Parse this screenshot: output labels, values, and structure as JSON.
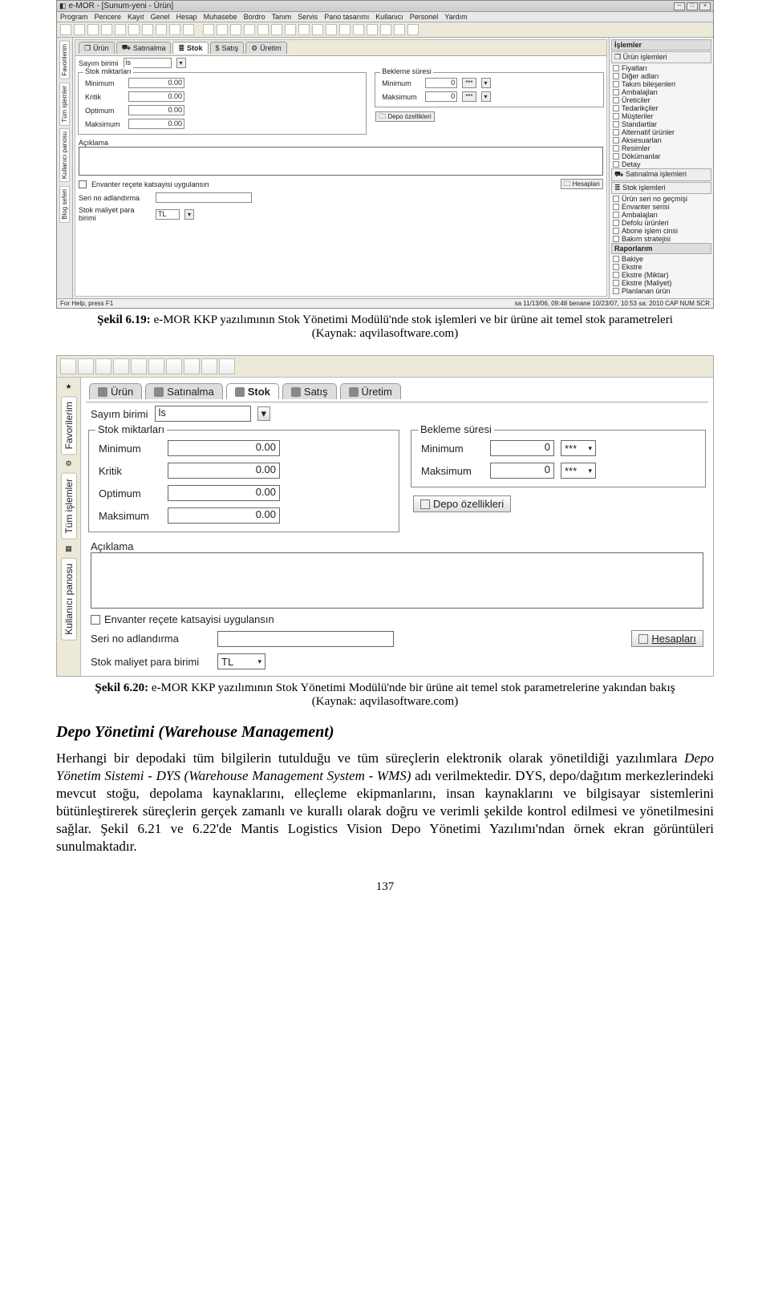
{
  "shot1": {
    "window_title": "e-MOR - [Sunum-yeni - Ürün]",
    "menus": [
      "Program",
      "Pencere",
      "Kayıt",
      "Genel",
      "Hesap",
      "Muhasebe",
      "Bordro",
      "Tanım",
      "Servis",
      "Pano tasarımı",
      "Kullanıcı",
      "Personel",
      "Yardım"
    ],
    "left_tabs": [
      "Favorilerim",
      "Tüm işlemler",
      "Kullanıcı panosu",
      "Blog seferi"
    ],
    "tabs": [
      "Ürün",
      "Satınalma",
      "Stok",
      "Satış",
      "Üretim"
    ],
    "sayim_label": "Sayım birimi",
    "sayim_value": "ls",
    "stok_group": {
      "title": "Stok miktarları",
      "rows": [
        {
          "label": "Minimum",
          "value": "0.00"
        },
        {
          "label": "Kritik",
          "value": "0.00"
        },
        {
          "label": "Optimum",
          "value": "0.00"
        },
        {
          "label": "Maksimum",
          "value": "0.00"
        }
      ]
    },
    "bekleme_group": {
      "title": "Bekleme süresi",
      "rows": [
        {
          "label": "Minimum",
          "value": "0",
          "unit": "***"
        },
        {
          "label": "Maksimum",
          "value": "0",
          "unit": "***"
        }
      ]
    },
    "depo_btn": "Depo özellikleri",
    "aciklama_label": "Açıklama",
    "envanter_label": "Envanter reçete katsayisi uygulansın",
    "hesap_btn": "Hesapları",
    "seri_label": "Seri no adlandırma",
    "maliyet_label": "Stok maliyet para birimi",
    "maliyet_value": "TL",
    "right": {
      "head1": "İşlemler",
      "grp1": "Ürün işlemleri",
      "items1": [
        "Fiyatları",
        "Diğer adları",
        "Takım bileşenleri",
        "Ambalajları",
        "Üreticiler",
        "Tedarikçiler",
        "Müşteriler",
        "Standartlar",
        "Alternatif ürünler",
        "Aksesuarları",
        "Resimler",
        "Dökümanlar",
        "Detay"
      ],
      "grp2": "Satınalma işlemleri",
      "grp3": "Stok işlemleri",
      "items3": [
        "Ürün seri no geçmişi",
        "Envanter serisi",
        "Ambalajları",
        "Defolu ürünleri",
        "Abone işlem cinsi",
        "Bakım stratejisi"
      ],
      "head2": "Raporlarım",
      "items4": [
        "Bakiye",
        "Ekstre",
        "Ekstre (Miktar)",
        "Ekstre (Maliyet)",
        "Planlanan ürün"
      ]
    },
    "status_left": "For Help, press F1",
    "status_right": "sa 11/13/06, 09:48    benane 10/23/07, 10:53    sa: 2010    CAP  NUM  SCR"
  },
  "caption1": {
    "bold": "Şekil 6.19: ",
    "text": "e-MOR KKP yazılımının Stok Yönetimi Modülü'nde stok işlemleri ve bir ürüne ait temel stok parametreleri",
    "source": "(Kaynak: aqvilasoftware.com)"
  },
  "shot2": {
    "left_tabs": [
      "Favorilerim",
      "Tüm işlemler",
      "Kullanıcı panosu"
    ],
    "tabs": [
      "Ürün",
      "Satınalma",
      "Stok",
      "Satış",
      "Üretim"
    ],
    "sayim_label": "Sayım birimi",
    "sayim_value": "ls",
    "stok_group": {
      "title": "Stok miktarları",
      "rows": [
        {
          "label": "Minimum",
          "value": "0.00"
        },
        {
          "label": "Kritik",
          "value": "0.00"
        },
        {
          "label": "Optimum",
          "value": "0.00"
        },
        {
          "label": "Maksimum",
          "value": "0.00"
        }
      ]
    },
    "bekleme_group": {
      "title": "Bekleme süresi",
      "rows": [
        {
          "label": "Minimum",
          "value": "0",
          "unit": "***"
        },
        {
          "label": "Maksimum",
          "value": "0",
          "unit": "***"
        }
      ]
    },
    "depo_btn": "Depo özellikleri",
    "aciklama_label": "Açıklama",
    "envanter_label": "Envanter reçete katsayisi uygulansın",
    "hesap_btn": "Hesapları",
    "seri_label": "Seri no adlandırma",
    "maliyet_label": "Stok maliyet para birimi",
    "maliyet_value": "TL"
  },
  "caption2": {
    "bold": "Şekil 6.20: ",
    "text": "e-MOR KKP yazılımının Stok Yönetimi Modülü'nde bir ürüne ait temel stok parametrelerine yakından bakış",
    "source": "(Kaynak: aqvilasoftware.com)"
  },
  "section_head": "Depo Yönetimi (Warehouse Management)",
  "body_text": "Herhangi bir depodaki tüm bilgilerin tutulduğu ve tüm süreçlerin elektronik olarak yönetildiği yazılımlara Depo Yönetim Sistemi - DYS (Warehouse Management System - WMS) adı verilmektedir. DYS, depo/dağıtım merkezlerindeki mevcut stoğu, depolama kaynaklarını, elleçleme ekipmanlarını, insan kaynaklarını ve bilgisayar sistemlerini bütünleştirerek süreçlerin gerçek zamanlı ve kurallı olarak doğru ve verimli şekilde kontrol edilmesi ve yönetilmesini sağlar. Şekil 6.21 ve 6.22'de Mantis Logistics Vision Depo Yönetimi Yazılımı'ndan örnek ekran görüntüleri sunulmaktadır.",
  "body_italic": "Depo Yönetim Sistemi - DYS (Warehouse Management System - WMS)",
  "page_number": "137"
}
